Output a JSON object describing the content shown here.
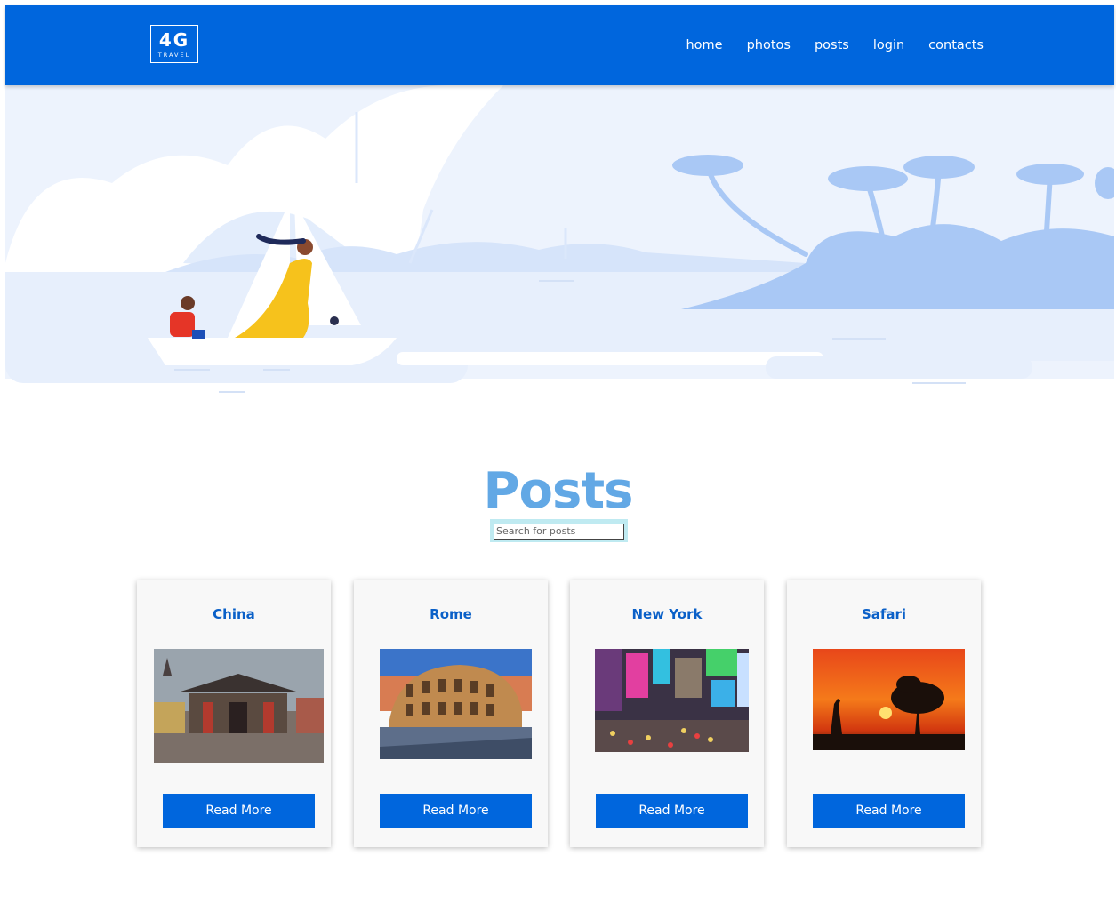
{
  "navbar": {
    "logo": {
      "main": "4G",
      "sub": "TRAVEL"
    },
    "links": [
      "home",
      "photos",
      "posts",
      "login",
      "contacts"
    ],
    "background": "#0066dd"
  },
  "posts": {
    "title": "Posts",
    "search_placeholder": "Search for posts"
  },
  "cards": [
    {
      "title": "China",
      "button": "Read More",
      "image": "china-gate-photo"
    },
    {
      "title": "Rome",
      "button": "Read More",
      "image": "colosseum-photo"
    },
    {
      "title": "New York",
      "button": "Read More",
      "image": "times-square-photo"
    },
    {
      "title": "Safari",
      "button": "Read More",
      "image": "safari-sunset-photo"
    }
  ],
  "colors": {
    "accent": "#0066dd",
    "title": "#62a8e5",
    "card_title": "#0a60c8",
    "hero_sky": "#eaf2fd",
    "hero_island": "#a9c8f5"
  }
}
